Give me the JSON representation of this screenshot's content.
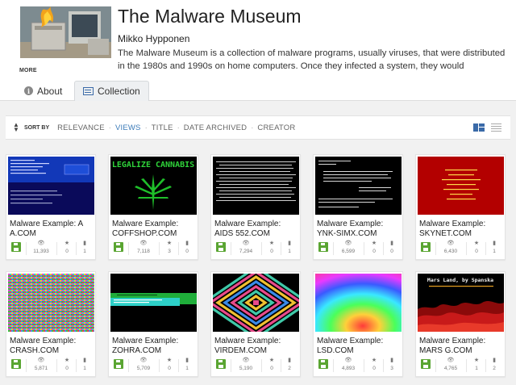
{
  "header": {
    "title": "The Malware Museum",
    "author": "Mikko Hypponen",
    "description": "The Malware Museum is a collection of malware programs, usually viruses, that were distributed in the 1980s and 1990s on home computers. Once they infected a system, they would sometimes show animation or messages that you",
    "more_label": "MORE"
  },
  "tabs": [
    {
      "label": "About",
      "icon": "info-icon"
    },
    {
      "label": "Collection",
      "icon": "list-icon"
    }
  ],
  "sortbar": {
    "label": "SORT BY",
    "options": [
      "RELEVANCE",
      "VIEWS",
      "TITLE",
      "DATE ARCHIVED",
      "CREATOR"
    ],
    "active": "VIEWS"
  },
  "colors": {
    "accent": "#3a7ab8",
    "disk": "#5aa532",
    "tab_bg": "#eef0f2"
  },
  "items": [
    {
      "title": "Malware Example: A A.COM",
      "views": "11,393",
      "favs": "0",
      "reviews": "1"
    },
    {
      "title": "Malware Example: COFFSHOP.COM",
      "views": "7,118",
      "favs": "3",
      "reviews": "0"
    },
    {
      "title": "Malware Example: AIDS 552.COM",
      "views": "7,294",
      "favs": "0",
      "reviews": "1"
    },
    {
      "title": "Malware Example: YNK-SIMX.COM",
      "views": "6,599",
      "favs": "0",
      "reviews": "0"
    },
    {
      "title": "Malware Example: SKYNET.COM",
      "views": "6,430",
      "favs": "0",
      "reviews": "1"
    },
    {
      "title": "Malware Example: CRASH.COM",
      "views": "5,871",
      "favs": "0",
      "reviews": "1"
    },
    {
      "title": "Malware Example: ZOHRA.COM",
      "views": "5,709",
      "favs": "0",
      "reviews": "1"
    },
    {
      "title": "Malware Example: VIRDEM.COM",
      "views": "5,190",
      "favs": "0",
      "reviews": "2"
    },
    {
      "title": "Malware Example: LSD.COM",
      "views": "4,893",
      "favs": "0",
      "reviews": "3"
    },
    {
      "title": "Malware Example: MARS G.COM",
      "views": "4,765",
      "favs": "1",
      "reviews": "2"
    }
  ],
  "thumb_texts": {
    "coffshop": "LEGALIZE  CANNABIS",
    "mars": "Mars Land, by Spanska"
  }
}
